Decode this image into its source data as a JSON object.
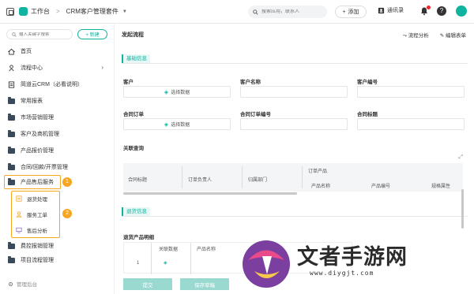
{
  "topbar": {
    "workspace_title": "工作台",
    "separator": ">",
    "app_name": "CRM客户管理套件",
    "search_placeholder": "搜索应用，联系人",
    "add_label": "添加",
    "contacts_label": "通讯录"
  },
  "sidebar": {
    "search_placeholder": "输入关键字搜索",
    "new_label": "+ 新建",
    "items": [
      {
        "label": "首页"
      },
      {
        "label": "流程中心"
      },
      {
        "label": "简道云CRM（必看说明）"
      },
      {
        "label": "常用报表"
      },
      {
        "label": "市场营销管理"
      },
      {
        "label": "客户及商机管理"
      },
      {
        "label": "产品报价管理"
      },
      {
        "label": "合同/回款/开票管理"
      },
      {
        "label": "产品售后服务"
      },
      {
        "label": "费控报销管理"
      },
      {
        "label": "项目流程管理"
      }
    ],
    "sub_items": [
      {
        "label": "退货处理"
      },
      {
        "label": "服务工单"
      },
      {
        "label": "售后分析"
      }
    ],
    "badge_1": "1",
    "badge_2": "2",
    "footer_label": "管理后台"
  },
  "main": {
    "title": "发起流程",
    "actions": {
      "flow_analysis": "流程分析",
      "edit_form": "编辑表单"
    },
    "section_basic": "基础信息",
    "fields": {
      "customer": "客户",
      "customer_name": "客户名称",
      "customer_no": "客户编号",
      "contract_order": "合同订单",
      "contract_order_no": "合同订单编号",
      "contract_title": "合同标题",
      "select_data": "选择数据"
    },
    "related_title": "关联查询",
    "related_table": {
      "col_contract_title": "合同标题",
      "col_order_owner": "订单负责人",
      "col_dept": "归属部门",
      "group_order_products": "订单产品",
      "col_product_name": "产品名称",
      "col_product_no": "产品编号",
      "col_spec": "规格属性"
    },
    "section_return": "退货信息",
    "return_sub": "退货产品明细",
    "return_table": {
      "col_related": "关联数据",
      "col_product_name": "产品名称",
      "row_index": "1"
    },
    "btn_submit": "提交",
    "btn_save_draft": "保存草稿"
  },
  "watermark": {
    "brand": "文者手游网",
    "url": "www.diygjt.com"
  },
  "colors": {
    "accent": "#0fb39f",
    "highlight": "#f5a623"
  }
}
